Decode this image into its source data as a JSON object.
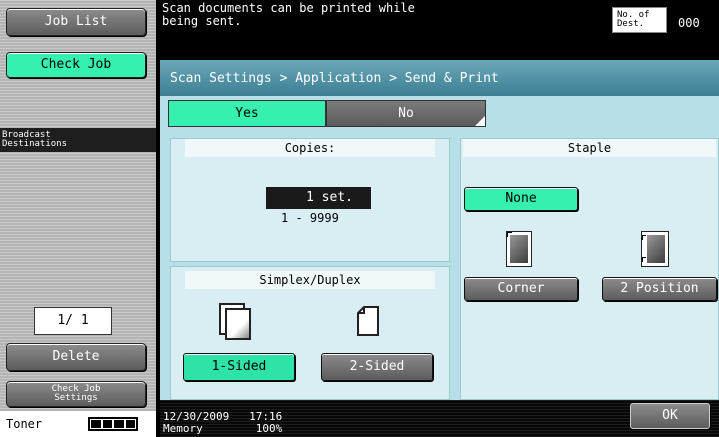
{
  "left_panel": {
    "job_list_label": "Job List",
    "check_job_label": "Check Job",
    "broadcast_label": "Broadcast\nDestinations",
    "page_indicator": "1/  1",
    "delete_label": "Delete",
    "check_job_settings_label": "Check Job\nSettings",
    "toner_label": "Toner",
    "toner_level": 1.0
  },
  "header": {
    "message": "Scan documents can be printed while\nbeing sent.",
    "dest_label": "No. of\nDest.",
    "dest_count": "000"
  },
  "main": {
    "breadcrumb": "Scan Settings > Application > Send & Print",
    "yes_label": "Yes",
    "no_label": "No",
    "copies": {
      "title": "Copies:",
      "value": "1 set.",
      "range": "1  -  9999"
    },
    "duplex": {
      "title": "Simplex/Duplex",
      "one_sided_label": "1-Sided",
      "two_sided_label": "2-Sided"
    },
    "staple": {
      "title": "Staple",
      "none_label": "None",
      "corner_label": "Corner",
      "two_position_label": "2 Position"
    }
  },
  "footer": {
    "datetime": "12/30/2009   17:16",
    "memory": "Memory        100%",
    "ok_label": "OK"
  },
  "colors": {
    "selected": "#36f0b0",
    "panel": "#b8dfe8",
    "breadcrumb_bar": "#3c7f93"
  }
}
